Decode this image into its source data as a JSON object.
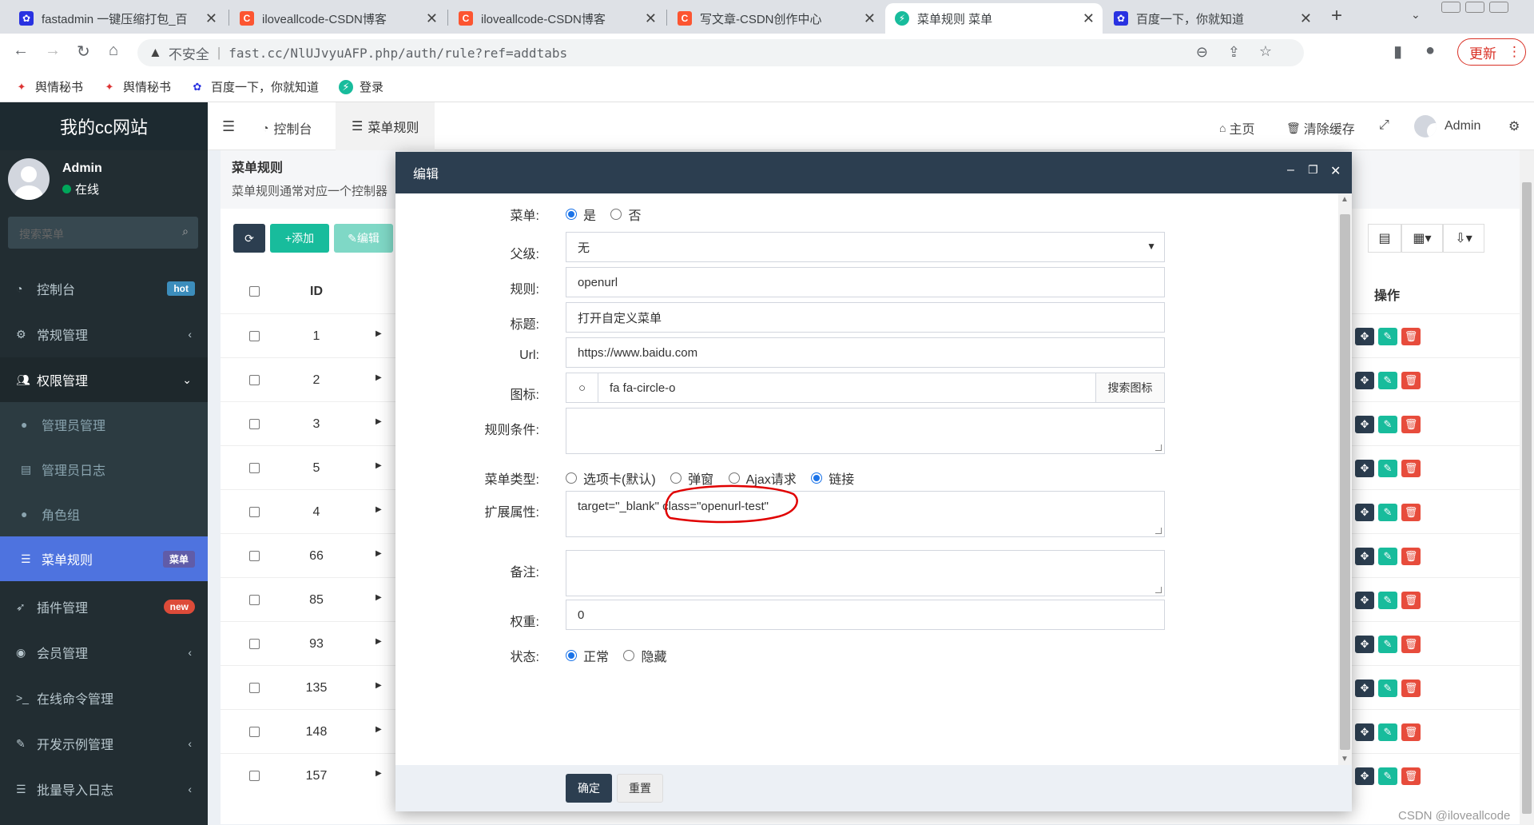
{
  "browser": {
    "tabs": [
      {
        "title": "fastadmin 一键压缩打包_百",
        "icon": "baidu-paw-icon",
        "color": "#2932e1"
      },
      {
        "title": "iloveallcode-CSDN博客",
        "icon": "csdn-c-icon",
        "color": "#fc5531"
      },
      {
        "title": "iloveallcode-CSDN博客",
        "icon": "csdn-c-icon",
        "color": "#fc5531"
      },
      {
        "title": "写文章-CSDN创作中心",
        "icon": "csdn-c-icon",
        "color": "#fc5531"
      },
      {
        "title": "菜单规则 菜单",
        "icon": "fastadmin-icon",
        "color": "#18bc9c"
      },
      {
        "title": "百度一下，你就知道",
        "icon": "baidu-paw-icon",
        "color": "#2932e1"
      }
    ],
    "security": "不安全",
    "url": "fast.cc/NlUJvyuAFP.php/auth/rule?ref=addtabs",
    "update_label": "更新",
    "bookmarks": [
      {
        "label": "舆情秘书",
        "icon": "bookmark-bird-icon"
      },
      {
        "label": "舆情秘书",
        "icon": "bookmark-bird-icon"
      },
      {
        "label": "百度一下，你就知道",
        "icon": "baidu-paw-icon"
      },
      {
        "label": "登录",
        "icon": "login-leaf-icon"
      }
    ]
  },
  "sidebar": {
    "site_title": "我的cc网站",
    "user": {
      "name": "Admin",
      "status": "在线"
    },
    "search_placeholder": "搜索菜单",
    "items": [
      {
        "label": "控制台",
        "icon": "dashboard-icon",
        "badge": "hot",
        "badge_color": "#3c8dbc"
      },
      {
        "label": "常规管理",
        "icon": "cogs-icon"
      },
      {
        "label": "权限管理",
        "icon": "group-icon"
      },
      {
        "label": "管理员管理",
        "icon": "user-icon"
      },
      {
        "label": "管理员日志",
        "icon": "list-alt-icon"
      },
      {
        "label": "角色组",
        "icon": "group-icon"
      },
      {
        "label": "菜单规则",
        "icon": "bars-icon",
        "badge": "菜单",
        "badge_color": "#605ca8"
      },
      {
        "label": "插件管理",
        "icon": "rocket-icon",
        "badge": "new",
        "badge_color": "#dd4b39"
      },
      {
        "label": "会员管理",
        "icon": "user-circle-icon"
      },
      {
        "label": "在线命令管理",
        "icon": "terminal-icon"
      },
      {
        "label": "开发示例管理",
        "icon": "magic-icon"
      },
      {
        "label": "批量导入日志",
        "icon": "list-icon"
      }
    ]
  },
  "topnav": {
    "tabs": [
      {
        "label": "控制台",
        "icon": "dashboard-icon"
      },
      {
        "label": "菜单规则",
        "icon": "bars-icon"
      }
    ],
    "home": "主页",
    "clear_cache": "清除缓存",
    "admin": "Admin"
  },
  "page": {
    "title": "菜单规则",
    "description": "菜单规则通常对应一个控制器",
    "toolbar": {
      "add": "添加",
      "edit": "编辑"
    },
    "columns": {
      "id": "ID",
      "ops": "操作"
    },
    "rows": [
      "1",
      "2",
      "3",
      "5",
      "4",
      "66",
      "85",
      "93",
      "135",
      "148",
      "157"
    ]
  },
  "modal": {
    "title": "编辑",
    "fields": {
      "menu_label": "菜单:",
      "menu_yes": "是",
      "menu_no": "否",
      "parent_label": "父级:",
      "parent_value": "无",
      "rule_label": "规则:",
      "rule_value": "openurl",
      "title_label": "标题:",
      "title_value": "打开自定义菜单",
      "url_label": "Url:",
      "url_value": "https://www.baidu.com",
      "icon_label": "图标:",
      "icon_value": "fa fa-circle-o",
      "icon_search": "搜索图标",
      "condition_label": "规则条件:",
      "menutype_label": "菜单类型:",
      "menutype_options": [
        "选项卡(默认)",
        "弹窗",
        "Ajax请求",
        "链接"
      ],
      "extend_label": "扩展属性:",
      "extend_value": "target=\"_blank\" class=\"openurl-test\"",
      "remark_label": "备注:",
      "weigh_label": "权重:",
      "weigh_value": "0",
      "status_label": "状态:",
      "status_normal": "正常",
      "status_hidden": "隐藏"
    },
    "submit": "确定",
    "reset": "重置"
  },
  "watermark": "CSDN @iloveallcode",
  "colors": {
    "sidebar_bg": "#222d32",
    "active_blue": "#4e73df",
    "modal_header": "#2c3e50",
    "success_green": "#18bc9c",
    "danger_red": "#e74c3c",
    "annotation_red": "#e00000"
  }
}
